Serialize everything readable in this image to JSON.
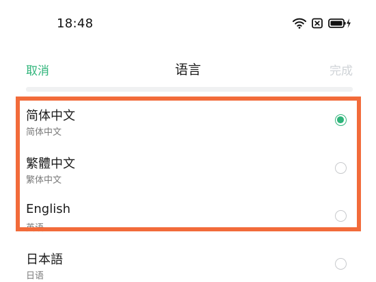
{
  "status_bar": {
    "time": "18:48",
    "icons": [
      "wifi-icon",
      "sim-blocked-icon",
      "battery-charging-icon"
    ]
  },
  "header": {
    "cancel_label": "取消",
    "title": "语言",
    "done_label": "完成"
  },
  "languages": [
    {
      "name": "简体中文",
      "subtitle": "简体中文",
      "selected": true
    },
    {
      "name": "繁體中文",
      "subtitle": "繁体中文",
      "selected": false
    },
    {
      "name": "English",
      "subtitle": "英语",
      "selected": false
    },
    {
      "name": "日本語",
      "subtitle": "日语",
      "selected": false
    }
  ],
  "colors": {
    "accent": "#2fb47a",
    "highlight": "#f26b3a",
    "disabled": "#cfd3d7"
  }
}
